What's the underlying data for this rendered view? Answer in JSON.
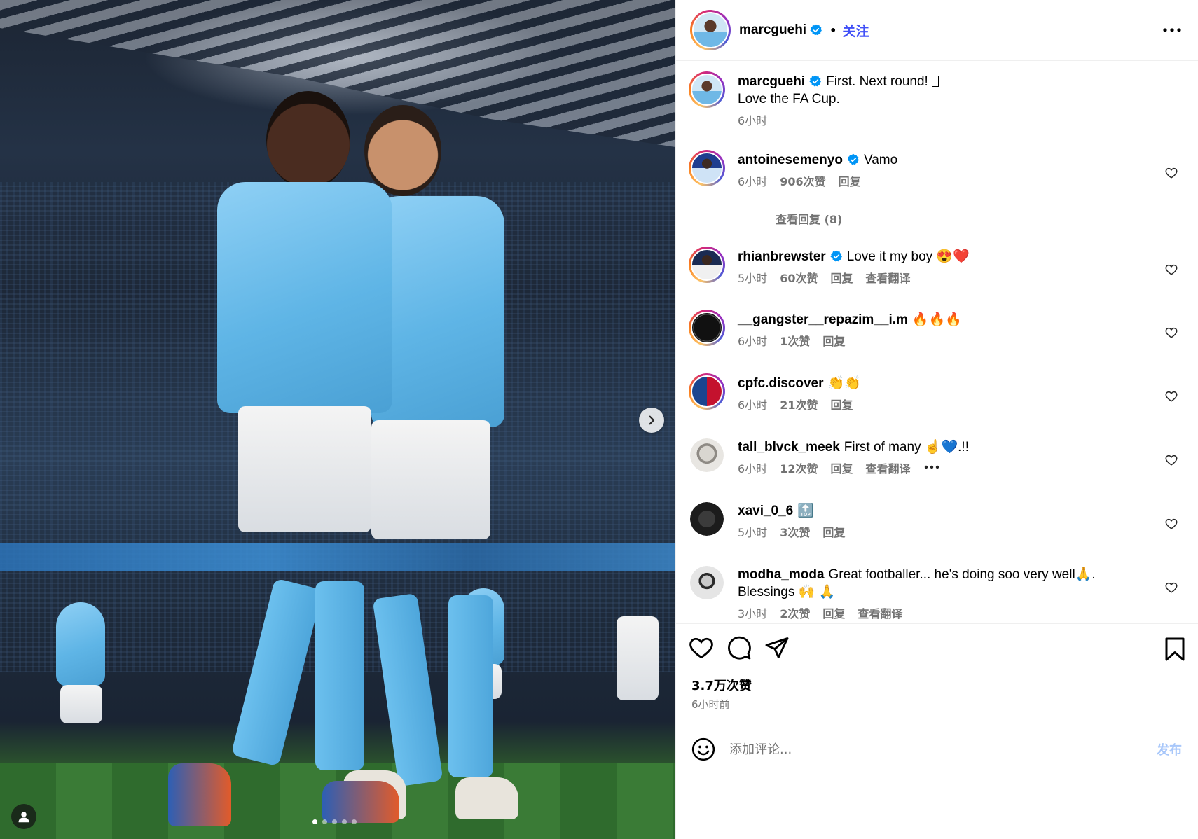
{
  "post": {
    "username": "marcguehi",
    "follow_label": "关注",
    "separator": "•",
    "caption_line1": "First. Next round! ",
    "caption_line2": "Love the FA Cup.",
    "caption_time": "6小时",
    "likes": "3.7万次赞",
    "posted_ago": "6小时前",
    "carousel_count": 5,
    "carousel_active": 0
  },
  "comments": [
    {
      "user": "antoinesemenyo",
      "text": "Vamo",
      "time": "6小时",
      "likes": "906次赞",
      "reply": "回复",
      "translate": ""
    },
    {
      "user": "rhianbrewster",
      "text": "Love it my boy 😍❤️",
      "time": "5小时",
      "likes": "60次赞",
      "reply": "回复",
      "translate": "查看翻译"
    },
    {
      "user": "__gangster__repazim__i.m",
      "text": "🔥🔥🔥",
      "time": "6小时",
      "likes": "1次赞",
      "reply": "回复",
      "translate": ""
    },
    {
      "user": "cpfc.discover",
      "text": "👏👏",
      "time": "6小时",
      "likes": "21次赞",
      "reply": "回复",
      "translate": ""
    },
    {
      "user": "tall_blvck_meek",
      "text": "First of many ☝💙.!!",
      "time": "6小时",
      "likes": "12次赞",
      "reply": "回复",
      "translate": "查看翻译"
    },
    {
      "user": "xavi_0_6",
      "text": "🔝",
      "time": "5小时",
      "likes": "3次赞",
      "reply": "回复",
      "translate": ""
    },
    {
      "user": "modha_moda",
      "text": "Great footballer... he's doing soo very well🙏. Blessings 🙌 🙏",
      "time": "3小时",
      "likes": "2次赞",
      "reply": "回复",
      "translate": "查看翻译"
    }
  ],
  "view_replies": "查看回复 (8)",
  "comment_box": {
    "placeholder": "添加评论...",
    "post_label": "发布"
  },
  "colors": {
    "accent": "#4150f7",
    "verified": "#0095f6",
    "muted": "#737373",
    "post_disabled": "#a8c7fa"
  }
}
